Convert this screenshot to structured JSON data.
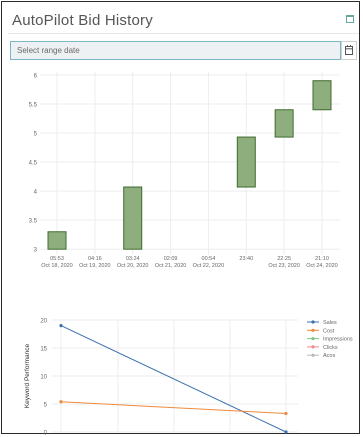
{
  "page": {
    "title": "AutoPilot Bid History"
  },
  "date_range": {
    "placeholder": "Select range date",
    "value": ""
  },
  "icons": {
    "window": "window-icon",
    "calendar": "calendar-icon"
  },
  "chart_data": [
    {
      "type": "bar",
      "subtype": "floating-range",
      "color": "#8fae7e",
      "stroke": "#3f6b2e",
      "ylim": [
        2.9,
        6.05
      ],
      "yticks": [
        "3",
        "3.5",
        "4",
        "4.5",
        "5",
        "5.5",
        "6"
      ],
      "ytick_values": [
        3,
        3.5,
        4,
        4.5,
        5,
        5.5,
        6
      ],
      "categories": [
        {
          "time": "05:53",
          "date": "Oct 18, 2020"
        },
        {
          "time": "04:16",
          "date": "Oct 19, 2020"
        },
        {
          "time": "03:24",
          "date": "Oct 20, 2020"
        },
        {
          "time": "02:09",
          "date": "Oct 21, 2020"
        },
        {
          "time": "00:54",
          "date": "Oct 22, 2020"
        },
        {
          "time": "23:40",
          "date": ""
        },
        {
          "time": "22:25",
          "date": "Oct 23, 2020"
        },
        {
          "time": "21:10",
          "date": "Oct 24, 2020"
        }
      ],
      "bars": [
        {
          "x_index": 0,
          "low": 3.0,
          "high": 3.3
        },
        {
          "x_index": 2,
          "low": 3.0,
          "high": 4.07
        },
        {
          "x_index": 5,
          "low": 4.07,
          "high": 4.93
        },
        {
          "x_index": 6,
          "low": 4.93,
          "high": 5.4
        },
        {
          "x_index": 7,
          "low": 5.4,
          "high": 5.9
        }
      ],
      "grid": true
    },
    {
      "type": "line",
      "ylabel": "Keyword Performance",
      "ylim": [
        0,
        20
      ],
      "yticks": [
        "0",
        "5",
        "10",
        "15",
        "20"
      ],
      "ytick_values": [
        0,
        5,
        10,
        15,
        20
      ],
      "x": [
        0,
        1
      ],
      "series": [
        {
          "name": "Sales",
          "color": "#3c6fb0",
          "values": [
            19,
            0
          ]
        },
        {
          "name": "Cost",
          "color": "#f08a3c",
          "values": [
            5.4,
            3.3
          ]
        },
        {
          "name": "Impressions",
          "color": "#7fc97f",
          "values": []
        },
        {
          "name": "Clicks",
          "color": "#f48a8a",
          "values": []
        },
        {
          "name": "Acos",
          "color": "#b9b9b9",
          "values": []
        }
      ],
      "legend": "right",
      "grid": true
    }
  ]
}
